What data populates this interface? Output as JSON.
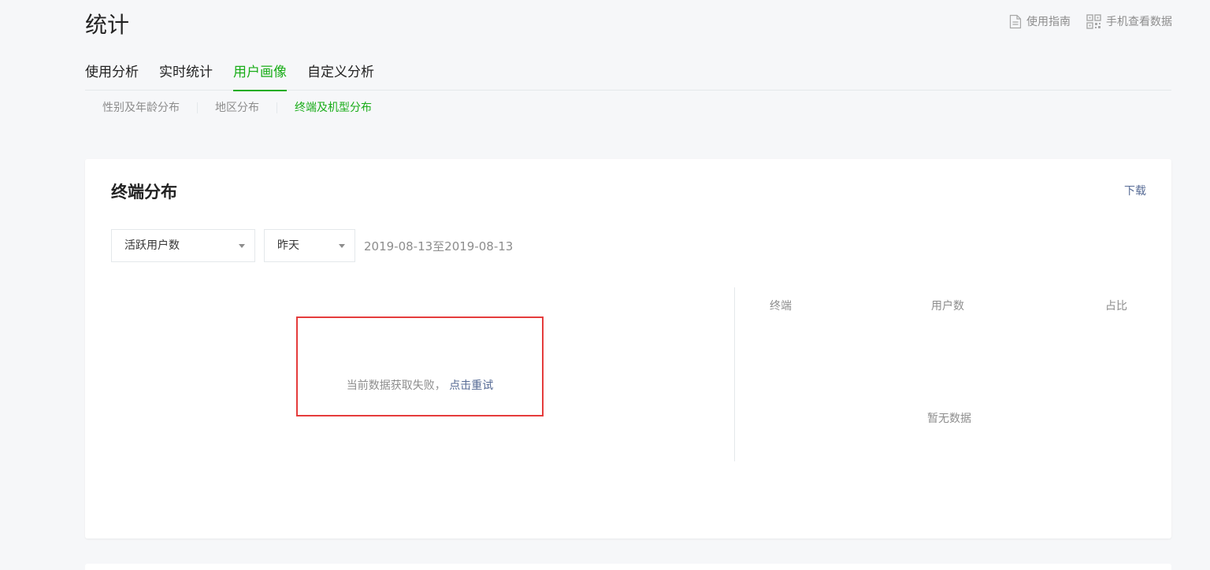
{
  "header": {
    "title": "统计",
    "guide_label": "使用指南",
    "mobile_label": "手机查看数据"
  },
  "main_tabs": [
    {
      "label": "使用分析",
      "active": false
    },
    {
      "label": "实时统计",
      "active": false
    },
    {
      "label": "用户画像",
      "active": true
    },
    {
      "label": "自定义分析",
      "active": false
    }
  ],
  "sub_tabs": [
    {
      "label": "性别及年龄分布",
      "active": false
    },
    {
      "label": "地区分布",
      "active": false
    },
    {
      "label": "终端及机型分布",
      "active": true
    }
  ],
  "card": {
    "title": "终端分布",
    "download_label": "下载",
    "metric_select": "活跃用户数",
    "date_select": "昨天",
    "date_range": "2019-08-13至2019-08-13",
    "error_text": "当前数据获取失败，",
    "retry_label": "点击重试",
    "table": {
      "columns": [
        "终端",
        "用户数",
        "占比"
      ],
      "empty_text": "暂无数据"
    }
  },
  "colors": {
    "accent": "#1aad19",
    "link": "#576b95",
    "highlight_box": "#e53c3c"
  },
  "icons": {
    "guide": "document-icon",
    "mobile": "qrcode-icon"
  }
}
